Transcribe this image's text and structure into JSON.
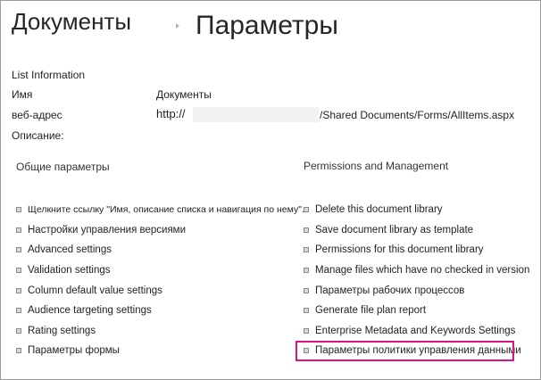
{
  "breadcrumb": {
    "parent": "Документы",
    "current": "Параметры"
  },
  "list_info": {
    "section_title": "List Information",
    "name_label": "Имя",
    "name_value": "Документы",
    "url_label": "веб-адрес",
    "url_prefix": "http://",
    "url_suffix": "/Shared Documents/Forms/AllItems.aspx",
    "description_label": "Описание:"
  },
  "general": {
    "title": "Общие параметры",
    "items": [
      "Щелкните ссылку \"Имя, описание списка и навигация по нему\".",
      "Настройки управления версиями",
      "Advanced settings",
      "Validation settings",
      "Column default value settings",
      "Audience targeting settings",
      "Rating settings",
      "Параметры формы"
    ]
  },
  "permissions": {
    "title": "Permissions and Management",
    "items": [
      "Delete this document library",
      "Save document library as template",
      "Permissions for this document library",
      "Manage files which have no checked in version",
      "Параметры рабочих процессов",
      "Generate file plan report",
      "Enterprise Metadata and Keywords Settings",
      "Параметры политики управления данными"
    ]
  },
  "colors": {
    "highlight": "#e0108a"
  }
}
